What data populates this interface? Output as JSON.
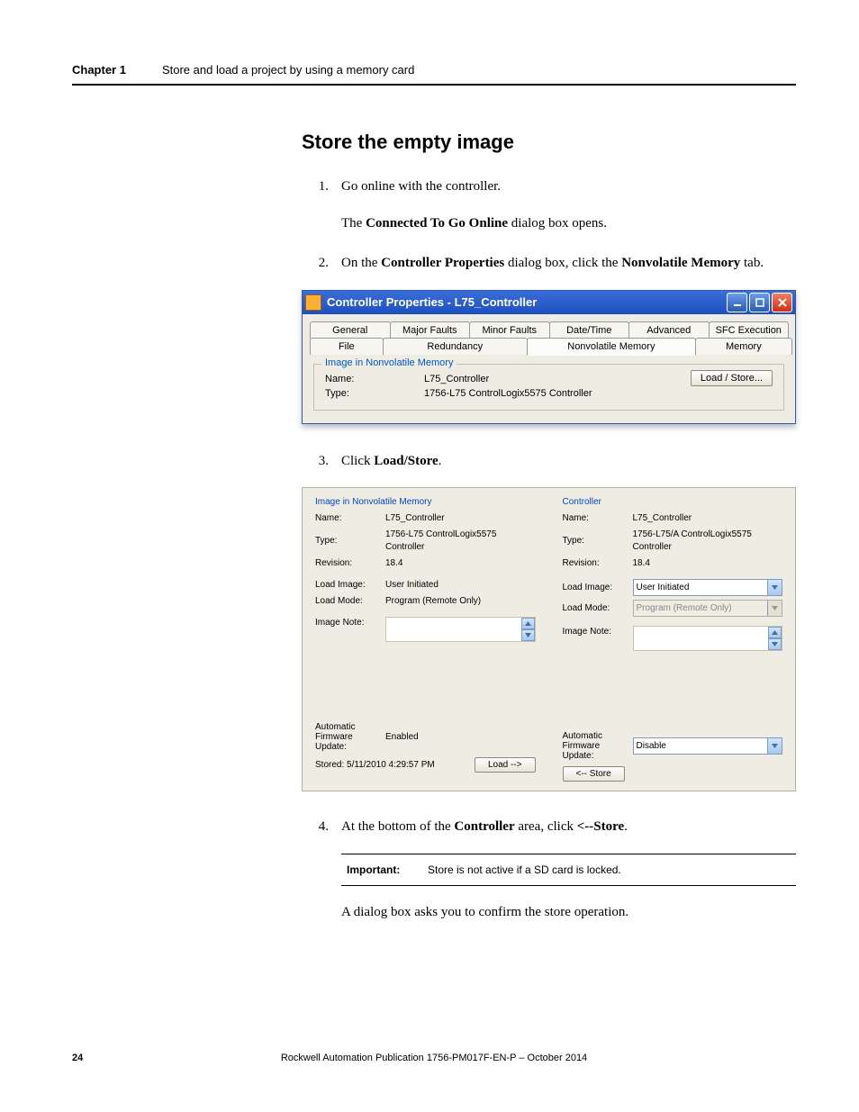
{
  "header": {
    "chapter_label": "Chapter 1",
    "chapter_title": "Store and load a project by using a memory card"
  },
  "section_heading": "Store the empty image",
  "steps": {
    "s1": {
      "num": "1.",
      "text_a": "Go online with the controller."
    },
    "s1_sub_a": "The ",
    "s1_sub_bold": "Connected To Go Online",
    "s1_sub_b": " dialog box opens.",
    "s2": {
      "num": "2.",
      "text_a": "On the ",
      "bold_a": "Controller Properties",
      "text_b": " dialog box, click the ",
      "bold_b": "Nonvolatile Memory",
      "text_c": " tab."
    },
    "s3": {
      "num": "3.",
      "text_a": "Click ",
      "bold_a": "Load/Store",
      "text_b": "."
    },
    "s4": {
      "num": "4.",
      "text_a": "At the bottom of the ",
      "bold_a": "Controller",
      "text_b": " area, click ",
      "bold_b": "<--Store",
      "text_c": "."
    }
  },
  "dialog1": {
    "title": "Controller Properties - L75_Controller",
    "tabs_row1": [
      "General",
      "Major Faults",
      "Minor Faults",
      "Date/Time",
      "Advanced",
      "SFC Execution"
    ],
    "tabs_row2": [
      "File",
      "Redundancy",
      "Nonvolatile Memory",
      "Memory"
    ],
    "active_tab_index_row2": 2,
    "group_title": "Image in Nonvolatile Memory",
    "name_label": "Name:",
    "name_value": "L75_Controller",
    "type_label": "Type:",
    "type_value": "1756-L75 ControlLogix5575 Controller",
    "load_store_btn": "Load / Store..."
  },
  "dialog2": {
    "left": {
      "title": "Image in Nonvolatile Memory",
      "name_label": "Name:",
      "name_value": "L75_Controller",
      "type_label": "Type:",
      "type_value": "1756-L75 ControlLogix5575 Controller",
      "rev_label": "Revision:",
      "rev_value": "18.4",
      "load_image_label": "Load Image:",
      "load_image_value": "User Initiated",
      "load_mode_label": "Load Mode:",
      "load_mode_value": "Program (Remote Only)",
      "image_note_label": "Image Note:",
      "auto_fw_label1": "Automatic",
      "auto_fw_label2": "Firmware Update:",
      "auto_fw_value": "Enabled",
      "stored_label": "Stored:",
      "stored_value": "5/11/2010  4:29:57 PM",
      "load_btn": "Load -->"
    },
    "right": {
      "title": "Controller",
      "name_label": "Name:",
      "name_value": "L75_Controller",
      "type_label": "Type:",
      "type_value": "1756-L75/A ControlLogix5575 Controller",
      "rev_label": "Revision:",
      "rev_value": "18.4",
      "load_image_label": "Load Image:",
      "load_image_value": "User Initiated",
      "load_mode_label": "Load Mode:",
      "load_mode_value": "Program (Remote Only)",
      "image_note_label": "Image Note:",
      "auto_fw_label1": "Automatic",
      "auto_fw_label2": "Firmware Update:",
      "auto_fw_value": "Disable",
      "store_btn": "<-- Store"
    }
  },
  "important": {
    "label": "Important:",
    "text": "Store is not active if a SD card is locked."
  },
  "closing_para": "A dialog box asks you to confirm the store operation.",
  "footer": {
    "page": "24",
    "pub": "Rockwell Automation Publication 1756-PM017F-EN-P – October 2014"
  }
}
